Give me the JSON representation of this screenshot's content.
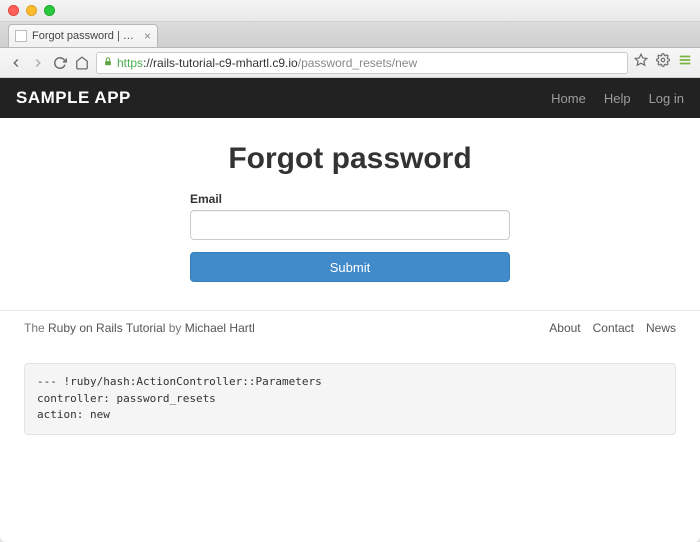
{
  "browser": {
    "tab_title": "Forgot password | Ruby o",
    "url": {
      "protocol": "https",
      "host": "://rails-tutorial-c9-mhartl.c9.io",
      "path": "/password_resets/new"
    }
  },
  "navbar": {
    "brand": "SAMPLE APP",
    "links": {
      "home": "Home",
      "help": "Help",
      "login": "Log in"
    }
  },
  "page": {
    "title": "Forgot password",
    "email_label": "Email",
    "email_value": "",
    "submit_label": "Submit"
  },
  "footer": {
    "byline_prefix": "The ",
    "tutorial_link": "Ruby on Rails Tutorial",
    "byline_mid": " by ",
    "author_link": "Michael Hartl",
    "links": {
      "about": "About",
      "contact": "Contact",
      "news": "News"
    }
  },
  "debug": "--- !ruby/hash:ActionController::Parameters\ncontroller: password_resets\naction: new"
}
